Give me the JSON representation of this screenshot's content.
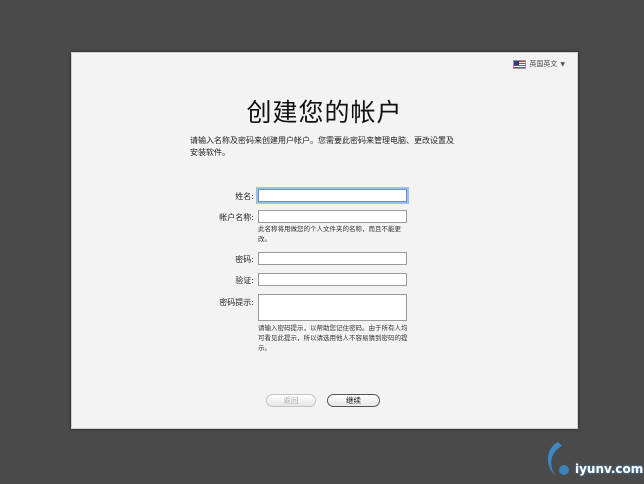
{
  "colors": {
    "background": "#4a4a4a",
    "panel": "#f3f3f3",
    "focus": "#9fbef0"
  },
  "language": {
    "label": "英国英文",
    "icon": "us-flag-icon",
    "caret": "▼"
  },
  "title": "创建您的帐户",
  "description": "请输入名称及密码来创建用户帐户。您需要此密码来管理电脑、更改设置及安装软件。",
  "form": {
    "full_name": {
      "label": "姓名:",
      "value": ""
    },
    "account_name": {
      "label": "帐户名称:",
      "value": "",
      "hint": "此名称将用做您的个人文件夹的名称，而且不能更改。"
    },
    "password": {
      "label": "密码:",
      "value": ""
    },
    "verify": {
      "label": "验证:",
      "value": ""
    },
    "password_hint": {
      "label": "密码提示:",
      "value": "",
      "hint": "请输入密码提示，以帮助您记住密码。由于所有人均可看见此提示，所以请选用他人不容易猜到密码的提示。"
    }
  },
  "buttons": {
    "back": "返回",
    "continue": "继续"
  },
  "watermark": {
    "text": "iyunv.com"
  }
}
